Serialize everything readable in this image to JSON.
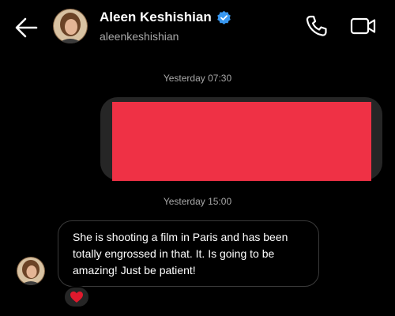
{
  "header": {
    "display_name": "Aleen Keshishian",
    "username": "aleenkeshishian",
    "verified": true,
    "icons": {
      "back": "arrow-left-icon",
      "call": "phone-icon",
      "video": "video-camera-icon",
      "verified": "verified-badge-icon"
    }
  },
  "messages": [
    {
      "timestamp": "Yesterday 07:30",
      "direction": "sent",
      "content": "",
      "redacted": true
    },
    {
      "timestamp": "Yesterday 15:00",
      "direction": "received",
      "text": "She is shooting a film in Paris and has been totally engrossed in that. It. Is going to be amazing! Just be patient!",
      "reaction": "❤️"
    }
  ],
  "colors": {
    "background": "#000000",
    "sent_bubble": "#262626",
    "redaction": "#ef3145",
    "verified": "#3897f0",
    "secondary_text": "#a8a8a8"
  }
}
